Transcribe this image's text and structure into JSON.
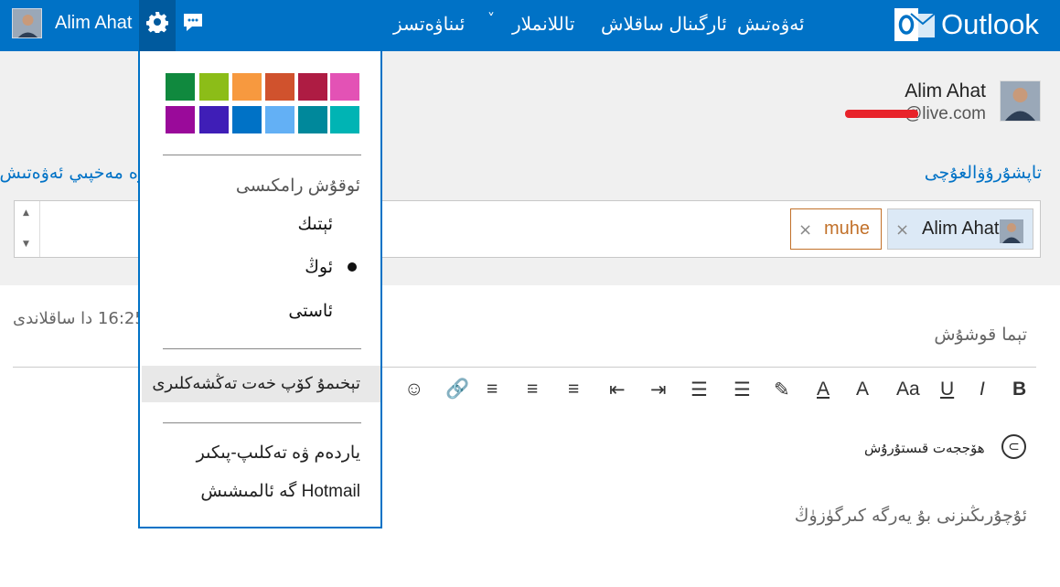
{
  "topbar": {
    "user_name": "Alim Ahat",
    "nav": {
      "new": "ئەۋەتىش",
      "sent": "ئارگىنال ساقلاش",
      "options": "تاللانملار",
      "contacts": "ئىناۋەتسز"
    },
    "logo": "Outlook",
    "icons": [
      "avatar",
      "gear-icon",
      "chat-icon",
      "chevron-down-icon",
      "outlook-logo"
    ]
  },
  "profile": {
    "name": "Alim Ahat",
    "email": "@live.com"
  },
  "compose": {
    "to_label": "تاپشۇرۇۋالغۇچى",
    "cc_label": "ۋە مەخپىي ئەۋەتىش",
    "recipients": [
      {
        "name": "Alim Ahat",
        "remove": "×"
      },
      {
        "name": "muhe",
        "remove": "×"
      }
    ],
    "saved_time": "16:25 دا ساقلاندى",
    "subject_placeholder": "تېما قوشۇش",
    "toolbar": [
      "B",
      "I",
      "U",
      "Aa",
      "A",
      "A",
      "✎",
      "☰",
      "☰",
      "⇥",
      "⇤",
      "≡",
      "≡",
      "≡",
      "🔗",
      "☺"
    ],
    "attach_label": "ھۆججەت قىستۇرۇش",
    "body_placeholder": "ئۇچۇرىڭىزنى بۇ يەرگە كىرگۈزۈڭ"
  },
  "settings_menu": {
    "colors": [
      "#10893e",
      "#8cbd18",
      "#f7993f",
      "#d0522d",
      "#ae1c43",
      "#e352b5",
      "#9a0a9a",
      "#3f1eb7",
      "#0072c6",
      "#63b0f5",
      "#00889b",
      "#00b4b4"
    ],
    "reading_pane_header": "ئوقۇش رامكىسى",
    "pane_options": [
      "ئېتىك",
      "ئوڭ",
      "ئاستى"
    ],
    "selected_option": "ئوڭ",
    "more_settings": "تېخىمۇ كۆپ خەت تەڭشەكلىرى",
    "help": "ياردەم ۋە تەكلىپ-پىكىر",
    "switch": "Hotmail گە ئالمىشىش"
  }
}
